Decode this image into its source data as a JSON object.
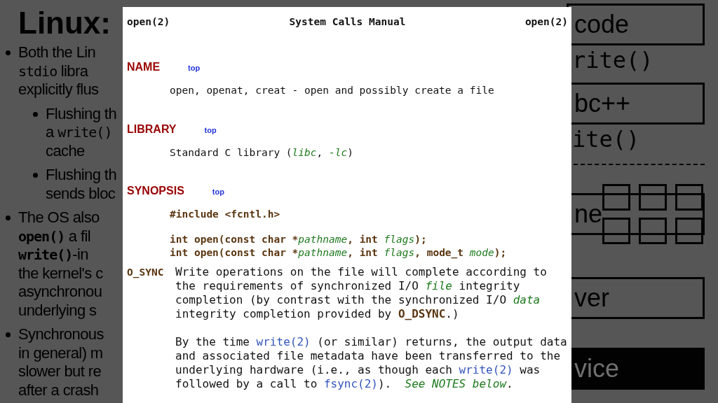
{
  "slide": {
    "title": "Linux:",
    "bullets": [
      {
        "lines": [
          [
            {
              "kind": "plain",
              "text": "Both the Lin"
            }
          ],
          [
            {
              "kind": "code",
              "text": "stdio"
            },
            {
              "kind": "plain",
              "text": " libra"
            }
          ],
          [
            {
              "kind": "plain",
              "text": "explicitly flus"
            }
          ]
        ],
        "children": [
          {
            "lines": [
              [
                {
                  "kind": "plain",
                  "text": "Flushing th"
                }
              ],
              [
                {
                  "kind": "plain",
                  "text": "a "
                },
                {
                  "kind": "code",
                  "text": "write()"
                }
              ],
              [
                {
                  "kind": "plain",
                  "text": "cache"
                }
              ]
            ]
          },
          {
            "lines": [
              [
                {
                  "kind": "plain",
                  "text": "Flushing th"
                }
              ],
              [
                {
                  "kind": "plain",
                  "text": "sends bloc"
                }
              ]
            ]
          }
        ]
      },
      {
        "lines": [
          [
            {
              "kind": "plain",
              "text": "The OS also"
            }
          ],
          [
            {
              "kind": "code_bold",
              "text": "open()"
            },
            {
              "kind": "plain",
              "text": " a fil"
            }
          ],
          [
            {
              "kind": "code_bold",
              "text": "write()"
            },
            {
              "kind": "plain",
              "text": "-in"
            }
          ],
          [
            {
              "kind": "plain",
              "text": "the kernel's c"
            }
          ],
          [
            {
              "kind": "plain",
              "text": "asynchronou"
            }
          ],
          [
            {
              "kind": "plain",
              "text": "underlying s"
            }
          ]
        ]
      },
      {
        "lines": [
          [
            {
              "kind": "plain",
              "text": "Synchronous"
            }
          ],
          [
            {
              "kind": "plain",
              "text": "in general) m"
            }
          ],
          [
            {
              "kind": "plain",
              "text": "slower but re"
            }
          ],
          [
            {
              "kind": "plain",
              "text": "after a crash"
            }
          ]
        ]
      }
    ],
    "diagram": [
      {
        "kind": "box",
        "text": "code"
      },
      {
        "kind": "code",
        "text": "rite()"
      },
      {
        "kind": "box",
        "text": "bc++"
      },
      {
        "kind": "code",
        "text": "ite()"
      },
      {
        "kind": "rule"
      },
      {
        "kind": "grid_box",
        "text": "ne"
      },
      {
        "kind": "box",
        "text": "ver"
      },
      {
        "kind": "dark_box",
        "text": "vice"
      }
    ]
  },
  "manpage": {
    "header": {
      "left": "open(2)",
      "center": "System Calls Manual",
      "right": "open(2)"
    },
    "sections": [
      {
        "heading": "NAME",
        "top_link": "top",
        "blocks": [
          [
            [
              {
                "kind": "plain",
                "text": "open, openat, creat - open and possibly create a file"
              }
            ]
          ]
        ]
      },
      {
        "heading": "LIBRARY",
        "top_link": "top",
        "blocks": [
          [
            [
              {
                "kind": "plain",
                "text": "Standard C library ("
              },
              {
                "kind": "italic",
                "text": "libc"
              },
              {
                "kind": "plain",
                "text": ", "
              },
              {
                "kind": "italic",
                "text": "-lc"
              },
              {
                "kind": "plain",
                "text": ")"
              }
            ]
          ]
        ]
      },
      {
        "heading": "SYNOPSIS",
        "top_link": "top",
        "blocks": [
          [
            [
              {
                "kind": "bold",
                "text": "#include <fcntl.h>"
              }
            ]
          ],
          [
            [
              {
                "kind": "bold",
                "text": "int open(const char *"
              },
              {
                "kind": "italic",
                "text": "pathname"
              },
              {
                "kind": "bold",
                "text": ", int "
              },
              {
                "kind": "italic",
                "text": "flags"
              },
              {
                "kind": "bold",
                "text": ");"
              }
            ],
            [
              {
                "kind": "bold",
                "text": "int open(const char *"
              },
              {
                "kind": "italic",
                "text": "pathname"
              },
              {
                "kind": "bold",
                "text": ", int "
              },
              {
                "kind": "italic",
                "text": "flags"
              },
              {
                "kind": "bold",
                "text": ", mode_t "
              },
              {
                "kind": "italic",
                "text": "mode"
              },
              {
                "kind": "bold",
                "text": ");"
              }
            ]
          ]
        ]
      }
    ],
    "options": [
      {
        "flag": "O_SYNC",
        "paragraphs": [
          [
            {
              "kind": "plain",
              "text": "Write operations on the file will complete according to the requirements of synchronized I/O "
            },
            {
              "kind": "italic",
              "text": "file"
            },
            {
              "kind": "plain",
              "text": " integrity completion (by contrast with the synchronized I/O "
            },
            {
              "kind": "italic",
              "text": "data"
            },
            {
              "kind": "plain",
              "text": " integrity completion provided by "
            },
            {
              "kind": "bold",
              "text": "O_DSYNC"
            },
            {
              "kind": "plain",
              "text": ".)"
            }
          ],
          [
            {
              "kind": "plain",
              "text": "By the time "
            },
            {
              "kind": "link",
              "text": "write(2)"
            },
            {
              "kind": "plain",
              "text": " (or similar) returns, the output data and associated file metadata have been transferred to the underlying hardware (i.e., as though each "
            },
            {
              "kind": "link",
              "text": "write(2)"
            },
            {
              "kind": "plain",
              "text": " was followed by a call to "
            },
            {
              "kind": "link",
              "text": "fsync(2)"
            },
            {
              "kind": "plain",
              "text": ").  "
            },
            {
              "kind": "italic",
              "text": "See NOTES below"
            },
            {
              "kind": "plain",
              "text": "."
            }
          ]
        ]
      }
    ]
  }
}
